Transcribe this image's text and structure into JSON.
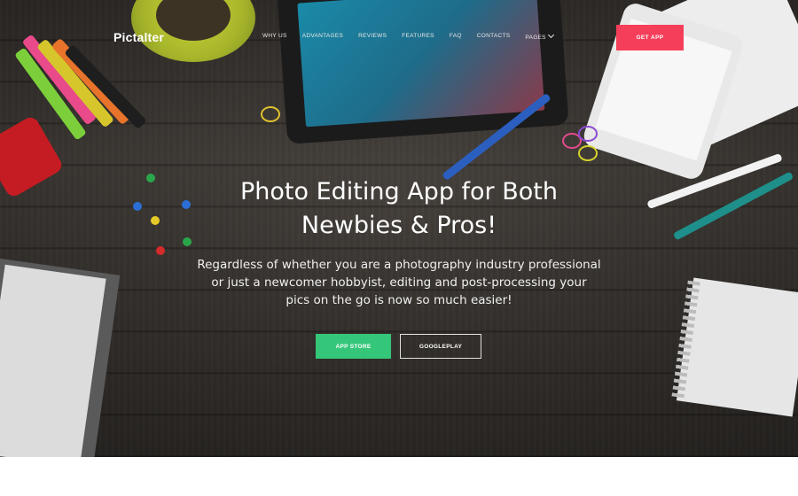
{
  "header": {
    "logo": "Pictalter",
    "nav": [
      {
        "label": "WHY US"
      },
      {
        "label": "ADVANTAGES"
      },
      {
        "label": "REVIEWS"
      },
      {
        "label": "FEATURES"
      },
      {
        "label": "FAQ"
      },
      {
        "label": "CONTACTS"
      },
      {
        "label": "PAGES",
        "icon": "chevron-down-icon"
      }
    ],
    "cta_label": "GET APP"
  },
  "hero": {
    "title_line1": "Photo Editing App for Both",
    "title_line2": "Newbies & Pros!",
    "text_line1": "Regardless of whether you are a photography industry professional",
    "text_line2": "or just a newcomer hobbyist, editing and post-processing your",
    "text_line3": "pics on the go is now so much easier!",
    "primary_button": "APP STORE",
    "secondary_button": "GOOGLEPLAY"
  },
  "colors": {
    "accent_red": "#f53e5a",
    "accent_green": "#35c779",
    "text_light": "#ffffff",
    "hero_bg": "#4a4540"
  }
}
